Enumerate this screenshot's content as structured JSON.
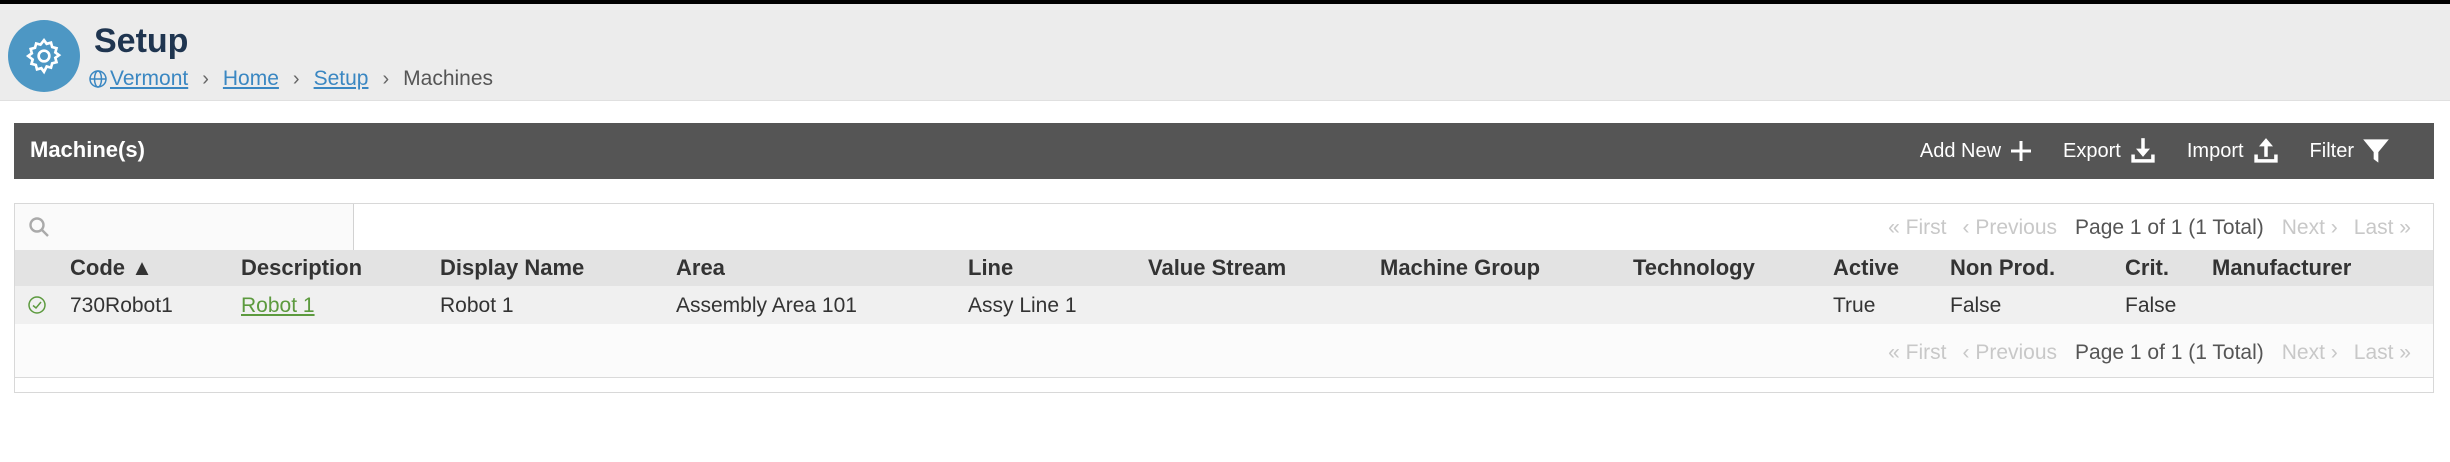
{
  "header": {
    "title": "Setup",
    "app_icon": "gear-icon",
    "accent_color": "#4d97c4"
  },
  "breadcrumb": {
    "items": [
      {
        "label": "Vermont",
        "icon": "globe-icon",
        "link": true
      },
      {
        "label": "Home",
        "link": true
      },
      {
        "label": "Setup",
        "link": true
      },
      {
        "label": "Machines",
        "link": false
      }
    ],
    "separator": "›"
  },
  "panel": {
    "title": "Machine(s)",
    "actions": {
      "add_new": "Add New",
      "export": "Export",
      "import": "Import",
      "filter": "Filter"
    }
  },
  "search": {
    "placeholder": "",
    "value": ""
  },
  "pager": {
    "first": "« First",
    "previous": "‹ Previous",
    "current": "Page 1 of 1 (1 Total)",
    "next": "Next ›",
    "last": "Last »"
  },
  "table": {
    "columns": [
      "Code ▲",
      "Description",
      "Display Name",
      "Area",
      "Line",
      "Value Stream",
      "Machine Group",
      "Technology",
      "Active",
      "Non Prod.",
      "Crit.",
      "Manufacturer"
    ],
    "rows": [
      {
        "code": "730Robot1",
        "description": "Robot 1",
        "display_name": "Robot 1",
        "area": "Assembly Area 101",
        "line": "Assy Line 1",
        "value_stream": "",
        "machine_group": "",
        "technology": "",
        "active": "True",
        "non_prod": "False",
        "crit": "False",
        "manufacturer": "",
        "status_icon": "check-circle-icon"
      }
    ]
  }
}
